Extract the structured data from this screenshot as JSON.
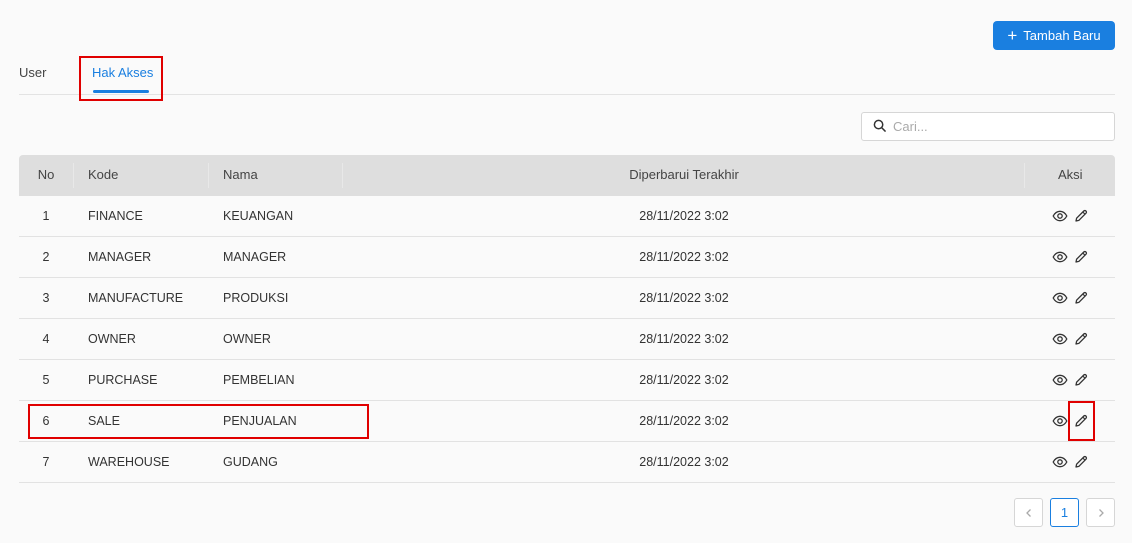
{
  "header": {
    "add_button_label": "Tambah Baru"
  },
  "tabs": [
    {
      "label": "User",
      "active": false
    },
    {
      "label": "Hak Akses",
      "active": true
    }
  ],
  "search": {
    "placeholder": "Cari..."
  },
  "table": {
    "columns": [
      "No",
      "Kode",
      "Nama",
      "Diperbarui Terakhir",
      "Aksi"
    ],
    "rows": [
      {
        "no": "1",
        "kode": "FINANCE",
        "nama": "KEUANGAN",
        "updated": "28/11/2022 3:02"
      },
      {
        "no": "2",
        "kode": "MANAGER",
        "nama": "MANAGER",
        "updated": "28/11/2022 3:02"
      },
      {
        "no": "3",
        "kode": "MANUFACTURE",
        "nama": "PRODUKSI",
        "updated": "28/11/2022 3:02"
      },
      {
        "no": "4",
        "kode": "OWNER",
        "nama": "OWNER",
        "updated": "28/11/2022 3:02"
      },
      {
        "no": "5",
        "kode": "PURCHASE",
        "nama": "PEMBELIAN",
        "updated": "28/11/2022 3:02"
      },
      {
        "no": "6",
        "kode": "SALE",
        "nama": "PENJUALAN",
        "updated": "28/11/2022 3:02"
      },
      {
        "no": "7",
        "kode": "WAREHOUSE",
        "nama": "GUDANG",
        "updated": "28/11/2022 3:02"
      }
    ],
    "row_actions": [
      "eye-icon",
      "pencil-icon"
    ]
  },
  "pagination": {
    "current_page": "1"
  },
  "colors": {
    "accent": "#1a7fe0",
    "highlight": "#e00000",
    "header_bg": "#dedede"
  }
}
